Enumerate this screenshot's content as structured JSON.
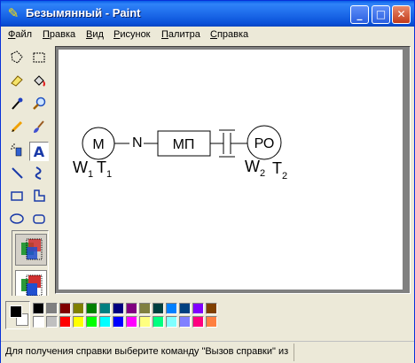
{
  "window": {
    "title": "Безымянный - Paint",
    "minimize_glyph": "_",
    "maximize_glyph": "□",
    "close_glyph": "✕"
  },
  "menu": [
    "Файл",
    "Правка",
    "Вид",
    "Рисунок",
    "Палитра",
    "Справка"
  ],
  "tools": [
    "free-select-icon",
    "rect-select-icon",
    "eraser-icon",
    "fill-icon",
    "picker-icon",
    "magnifier-icon",
    "pencil-icon",
    "brush-icon",
    "airbrush-icon",
    "text-icon",
    "line-icon",
    "curve-icon",
    "rectangle-icon",
    "polygon-icon",
    "ellipse-icon",
    "rounded-rect-icon"
  ],
  "active_tool": "text-icon",
  "text_tool_glyph": "A",
  "diagram": {
    "motor": "M",
    "n_label": "N",
    "mp": "МП",
    "po": "РО",
    "w1": "W",
    "w1_sub": "1",
    "t1": "T",
    "t1_sub": "1",
    "w2": "W",
    "w2_sub": "2",
    "t2": "T",
    "t2_sub": "2"
  },
  "palette": {
    "foreground": "#000000",
    "background": "#ffffff",
    "row1": [
      "#000000",
      "#808080",
      "#800000",
      "#808000",
      "#008000",
      "#008080",
      "#000080",
      "#800080",
      "#808040",
      "#004040",
      "#0080ff",
      "#004080",
      "#8000ff",
      "#804000"
    ],
    "row2": [
      "#ffffff",
      "#c0c0c0",
      "#ff0000",
      "#ffff00",
      "#00ff00",
      "#00ffff",
      "#0000ff",
      "#ff00ff",
      "#ffff80",
      "#00ff80",
      "#80ffff",
      "#8080ff",
      "#ff0080",
      "#ff8040"
    ]
  },
  "status": {
    "text": "Для получения справки выберите команду \"Вызов справки\" из"
  }
}
